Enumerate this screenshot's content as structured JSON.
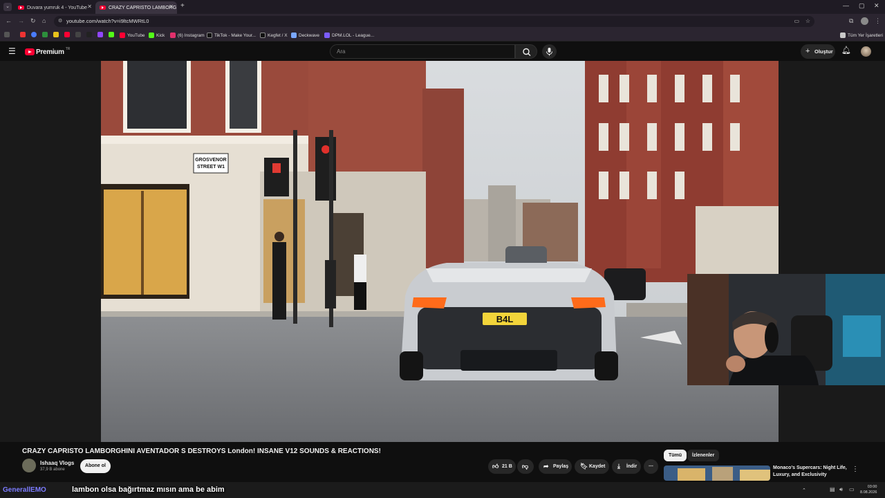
{
  "browser": {
    "tabs": [
      {
        "title": "Duvara yumruk 4 - YouTube",
        "active": false
      },
      {
        "title": "CRAZY CAPRISTO LAMBORG",
        "active": true
      }
    ],
    "url": "youtube.com/watch?v=i9ltcMWRtL0",
    "bookmarks": [
      {
        "label": "YouTube",
        "color": "#ff0033"
      },
      {
        "label": "Kick",
        "color": "#53fc18"
      },
      {
        "label": "(6) Instagram",
        "color": "#e1306c"
      },
      {
        "label": "TikTok - Make Your...",
        "color": "#ffffff"
      },
      {
        "label": "Kegfet / X",
        "color": "#ffffff"
      },
      {
        "label": "Deckwave",
        "color": "#7aa7ff"
      },
      {
        "label": "DPM.LOL - League...",
        "color": "#7b5cff"
      }
    ],
    "all_bookmarks": "Tüm Yer İşaretleri"
  },
  "youtube": {
    "logo": "Premium",
    "logo_region": "TR",
    "search_placeholder": "Ara",
    "create_label": "Oluştur"
  },
  "video": {
    "title": "CRAZY CAPRISTO LAMBORGHINI AVENTADOR S DESTROYS London! INSANE V12 SOUNDS & REACTIONS!",
    "channel": "Ishaaq Vlogs",
    "subscribers": "37,9 B abone",
    "subscribe_label": "Abone ol",
    "likes": "21 B",
    "share_label": "Paylaş",
    "save_label": "Kaydet",
    "download_label": "İndir",
    "scene": {
      "street_sign_line1": "GROSVENOR",
      "street_sign_line2": "STREET W1",
      "plate": "B4L"
    }
  },
  "recommendations": {
    "chips": [
      "Tümü",
      "İzlenenler"
    ],
    "first_title": "Monaco's Supercars: Night Life, Luxury, and Exclusivity"
  },
  "overlay": {
    "chat_name": "GenerallEMO",
    "chat_message": "lambon olsa bağırtmaz mısın ama be abim"
  },
  "taskbar": {
    "time": "03:00",
    "date": "8.08.2026"
  }
}
